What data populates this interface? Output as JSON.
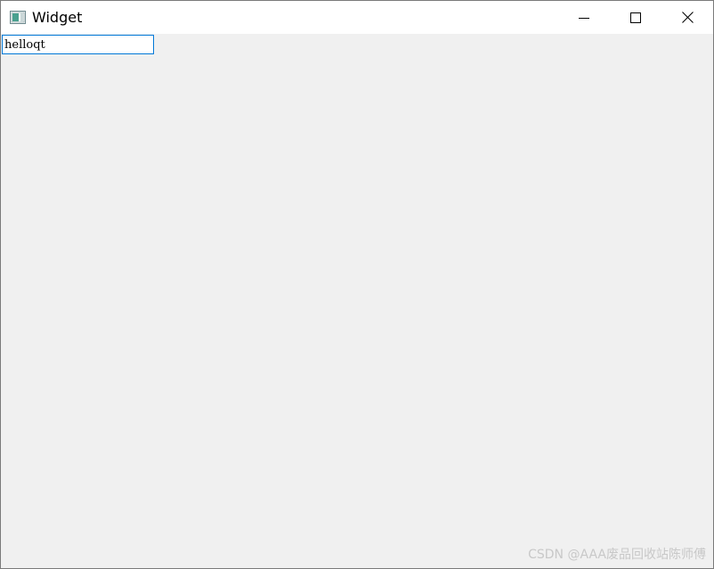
{
  "window": {
    "title": "Widget",
    "icon": "qt-window-icon",
    "controls": {
      "minimize": "minimize-icon",
      "maximize": "maximize-icon",
      "close": "close-icon"
    }
  },
  "line_edit": {
    "value": "helloqt"
  },
  "watermark": {
    "text": "CSDN @AAA废品回收站陈师傅"
  },
  "colors": {
    "titlebar": "#ffffff",
    "client": "#f0f0f0",
    "focus_border": "#0078d7",
    "watermark": "#c8c8c8"
  }
}
